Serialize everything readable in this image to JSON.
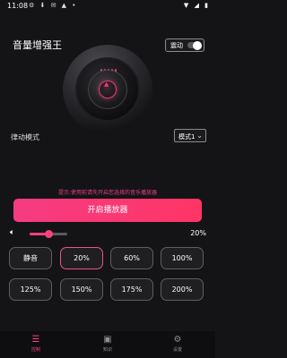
{
  "status_bar": {
    "time": "11:08",
    "left_icons": "⚙ ⬇ ✉ ▲ •",
    "right_icons": "▼ ◢ ▮"
  },
  "app": {
    "title": "音量增强王"
  },
  "vibrate_toggle": {
    "label": "震动",
    "on": false
  },
  "rhythm_mode": {
    "label": "律动模式",
    "selected": "模式1",
    "chevron": "⌄"
  },
  "hint": "提示:使用前请先开启您选择的音乐播放器",
  "start_button": {
    "label": "开启播放器"
  },
  "volume": {
    "icon": "volume-icon",
    "level_percent": 50,
    "value_text": "20%"
  },
  "presets": [
    {
      "label": "静音",
      "active": false
    },
    {
      "label": "20%",
      "active": true
    },
    {
      "label": "60%",
      "active": false
    },
    {
      "label": "100%",
      "active": false
    },
    {
      "label": "125%",
      "active": false
    },
    {
      "label": "150%",
      "active": false
    },
    {
      "label": "175%",
      "active": false
    },
    {
      "label": "200%",
      "active": false
    }
  ],
  "bottom_nav": [
    {
      "label": "控制",
      "icon": "equalizer-icon",
      "active": true
    },
    {
      "label": "知识",
      "icon": "book-icon",
      "active": false
    },
    {
      "label": "设置",
      "icon": "settings-icon",
      "active": false
    }
  ],
  "colors": {
    "accent": "#ff3f7a",
    "background": "#141416",
    "hint": "#e8408a"
  }
}
